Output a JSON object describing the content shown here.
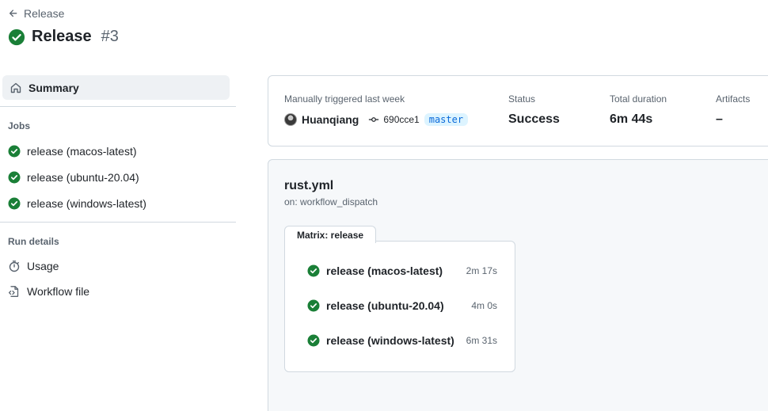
{
  "header": {
    "back_label": "Release",
    "run_title": "Release",
    "run_number": "#3"
  },
  "sidebar": {
    "summary_label": "Summary",
    "jobs_heading": "Jobs",
    "jobs": [
      {
        "label": "release (macos-latest)"
      },
      {
        "label": "release (ubuntu-20.04)"
      },
      {
        "label": "release (windows-latest)"
      }
    ],
    "run_details_heading": "Run details",
    "details": [
      {
        "label": "Usage"
      },
      {
        "label": "Workflow file"
      }
    ]
  },
  "run_info": {
    "trigger_text": "Manually triggered last week",
    "actor": "Huanqiang",
    "commit": "690cce1",
    "branch": "master",
    "status_label": "Status",
    "status_value": "Success",
    "duration_label": "Total duration",
    "duration_value": "6m 44s",
    "artifacts_label": "Artifacts",
    "artifacts_value": "–"
  },
  "workflow": {
    "file": "rust.yml",
    "trigger": "on: workflow_dispatch",
    "matrix_label": "Matrix: release",
    "jobs": [
      {
        "name": "release (macos-latest)",
        "duration": "2m 17s"
      },
      {
        "name": "release (ubuntu-20.04)",
        "duration": "4m 0s"
      },
      {
        "name": "release (windows-latest)",
        "duration": "6m 31s"
      }
    ]
  },
  "colors": {
    "success": "#1a7f37",
    "link": "#0969da",
    "muted": "#59636e",
    "border": "#d1d9e0"
  }
}
